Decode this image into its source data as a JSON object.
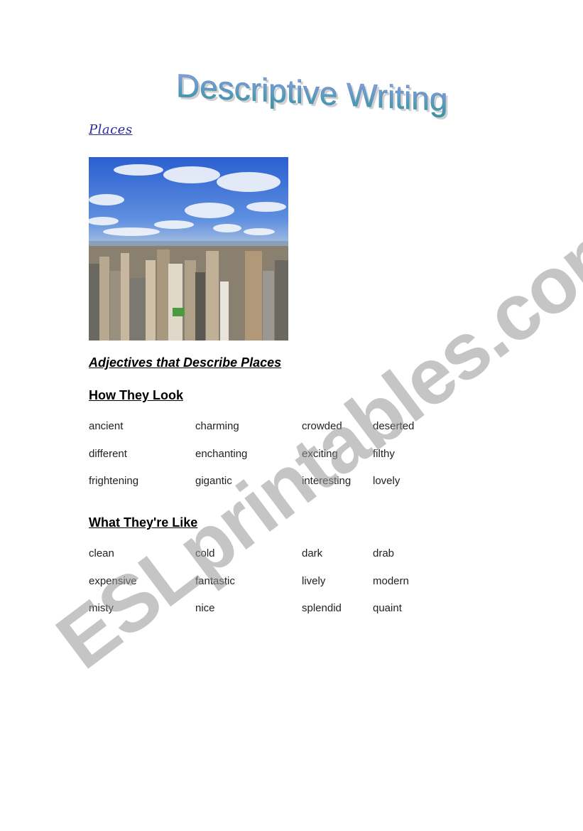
{
  "document": {
    "title": "Descriptive Writing",
    "subtitle_link": "Places",
    "photo_alt": "Aerial view of a city skyline with skyscrapers under a blue sky with clouds",
    "main_heading": "Adjectives that Describe Places",
    "sections": [
      {
        "heading": "How They Look",
        "words": [
          [
            "ancient",
            "charming",
            "crowded",
            "deserted"
          ],
          [
            "different",
            "enchanting",
            "exciting",
            "filthy"
          ],
          [
            "frightening",
            "gigantic",
            "interesting",
            "lovely"
          ]
        ]
      },
      {
        "heading": "What They're Like",
        "words": [
          [
            "clean",
            "cold",
            "dark",
            "drab"
          ],
          [
            "expensive",
            "fantastic",
            "lively",
            "modern"
          ],
          [
            "misty",
            "nice",
            "splendid",
            "quaint"
          ]
        ]
      }
    ],
    "watermark": "ESLprintables.com"
  },
  "colors": {
    "title_gradient_start": "#8a8fe0",
    "title_gradient_end": "#2a9a9a",
    "link": "#2a2a9a",
    "watermark": "#969696"
  }
}
